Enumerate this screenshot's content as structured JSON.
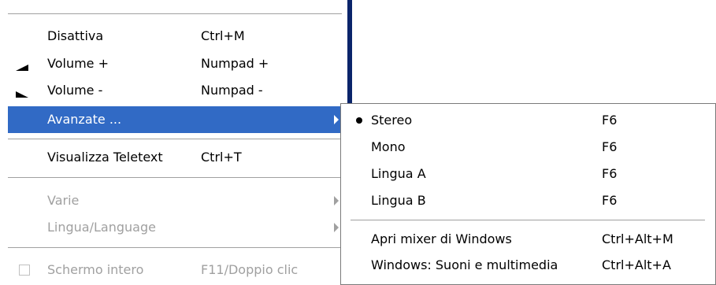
{
  "main_menu": {
    "items": [
      {
        "label": "Disattiva",
        "shortcut": "Ctrl+M"
      },
      {
        "label": "Volume +",
        "shortcut": "Numpad +",
        "icon": "volume-up-icon"
      },
      {
        "label": "Volume -",
        "shortcut": "Numpad -",
        "icon": "volume-down-icon"
      },
      {
        "label": "Avanzate ...",
        "shortcut": "",
        "submenu": true,
        "highlighted": true
      },
      {
        "label": "Visualizza Teletext",
        "shortcut": "Ctrl+T"
      },
      {
        "label": "Varie",
        "shortcut": "",
        "submenu": true,
        "disabled": true
      },
      {
        "label": "Lingua/Language",
        "shortcut": "",
        "submenu": true,
        "disabled": true
      },
      {
        "label": "Schermo intero",
        "shortcut": "F11/Doppio clic",
        "disabled": true,
        "checkbox": true
      }
    ]
  },
  "submenu": {
    "items": [
      {
        "label": "Stereo",
        "shortcut": "F6",
        "checked": true
      },
      {
        "label": "Mono",
        "shortcut": "F6"
      },
      {
        "label": "Lingua A",
        "shortcut": "F6"
      },
      {
        "label": "Lingua B",
        "shortcut": "F6"
      },
      {
        "label": "Apri mixer di Windows",
        "shortcut": "Ctrl+Alt+M"
      },
      {
        "label": "Windows: Suoni e multimedia",
        "shortcut": "Ctrl+Alt+A"
      }
    ]
  },
  "colors": {
    "highlight": "#316ac5",
    "disabled_text": "#a0a0a0",
    "accent_bar": "#0a246a"
  }
}
